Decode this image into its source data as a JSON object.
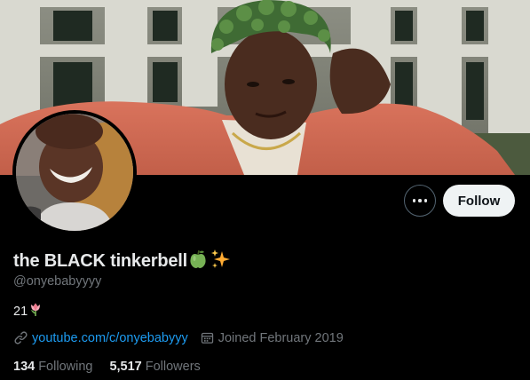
{
  "profile": {
    "display_name": "the BLACK tinkerbell",
    "name_emojis": [
      "🍏",
      "✨"
    ],
    "handle": "@onyebabyyyy",
    "bio_text": "21",
    "bio_emoji": "🌷",
    "website": "youtube.com/c/onyebabyyy",
    "joined": "Joined February 2019"
  },
  "actions": {
    "follow_label": "Follow",
    "more_icon": "ellipsis-icon"
  },
  "stats": {
    "following_count": "134",
    "following_label": "Following",
    "followers_count": "5,517",
    "followers_label": "Followers"
  },
  "icons": {
    "link": "link-icon",
    "calendar": "calendar-icon"
  },
  "colors": {
    "background": "#000000",
    "link": "#1d9bf0",
    "muted": "#71767b",
    "text": "#e7e9ea",
    "follow_button_bg": "#eff3f4"
  }
}
